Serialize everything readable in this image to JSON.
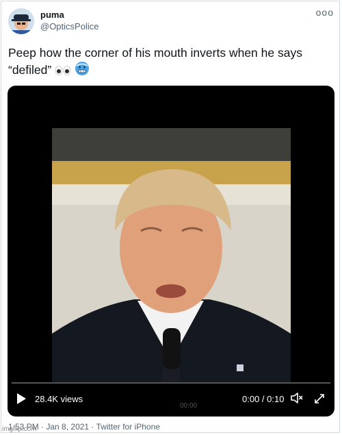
{
  "tweet": {
    "display_name": "puma",
    "handle": "@OpticsPolice",
    "more_icon": "ooo",
    "text": "Peep how the corner of his mouth inverts when he says “defiled”",
    "emojis": [
      "eyes-emoji",
      "cold-face-emoji"
    ]
  },
  "video": {
    "views": "28.4K views",
    "time": "0:00 / 0:10",
    "watermark": "00:00",
    "progress": 0.0
  },
  "footer": {
    "time": "1:53 PM",
    "sep1": " · ",
    "date": "Jan 8, 2021",
    "sep2": " · ",
    "source": "Twitter for iPhone",
    "watermark": "imgflip.com"
  },
  "colors": {
    "text": "#0f1419",
    "secondary": "#536471",
    "video_bg": "#000000",
    "border": "#cfd9de"
  }
}
